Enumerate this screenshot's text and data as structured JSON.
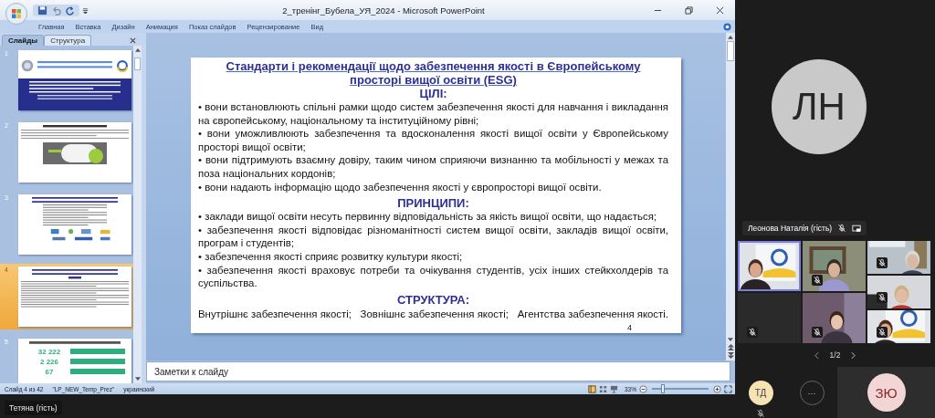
{
  "window": {
    "title": "2_тренінг_Бубела_УЯ_2024 - Microsoft PowerPoint"
  },
  "ribbon_tabs": [
    "Главная",
    "Вставка",
    "Дизайн",
    "Анимация",
    "Показ слайдов",
    "Рецензирование",
    "Вид"
  ],
  "pane_tabs": [
    {
      "label": "Слайды",
      "selected": true
    },
    {
      "label": "Структура",
      "selected": false
    }
  ],
  "thumbnails": [
    {
      "number": "1",
      "kind": "title-slide",
      "selected": false
    },
    {
      "number": "2",
      "kind": "text-photo",
      "selected": false
    },
    {
      "number": "3",
      "kind": "text-logos",
      "selected": false
    },
    {
      "number": "4",
      "kind": "text",
      "selected": true
    },
    {
      "number": "5",
      "kind": "figures",
      "selected": false,
      "texts": [
        "32 222",
        "2 226",
        "67"
      ]
    }
  ],
  "slide": {
    "title": "Стандарти і рекомендації щодо забезпечення якості в Європейському просторі вищої освіти (ESG)",
    "sections": [
      {
        "kind": "bullets",
        "heading": "ЦІЛІ:",
        "items": [
          "• вони встановлюють спільні рамки щодо систем забезпечення якості для навчання і викладання на європейському, національному та інституційному рівні;",
          "• вони уможливлюють забезпечення та вдосконалення якості вищої освіти у Європейському просторі вищої освіти;",
          "• вони підтримують взаємну довіру, таким чином сприяючи визнанню та мобільності у межах та поза національних кордонів;",
          "• вони надають інформацію щодо забезпечення якості у європросторі вищої освіти."
        ]
      },
      {
        "kind": "bullets",
        "heading": "ПРИНЦИПИ:",
        "items": [
          "• заклади вищої освіти несуть первинну відповідальність за якість вищої освіти, що надається;",
          "• забезпечення якості відповідає різноманітності систем вищої освіти, закладів вищої освіти, програм і студентів;",
          "• забезпечення якості сприяє розвитку культури якості;",
          "• забезпечення якості враховує потреби та очікування студентів, усіх інших стейкхолдерів та суспільства."
        ]
      },
      {
        "kind": "columns",
        "heading": "СТРУКТУРА:",
        "items": [
          "Внутрішнє забезпечення якості;",
          "Зовнішнє забезпечення якості;",
          "Агентства забезпечення якості."
        ]
      }
    ],
    "page_number": "4"
  },
  "notes": {
    "placeholder": "Заметки к слайду"
  },
  "status_bar": {
    "slide": "Слайд 4 из 42",
    "theme": "\"LP_NEW_Temp_Prez\"",
    "language": "украинский",
    "zoom": "33%",
    "zoom_slider": {
      "level": 0.2
    }
  },
  "guest_label": "Тетяна (гість)",
  "call": {
    "main_avatar": "ЛН",
    "speaker": {
      "name": "Леонова Наталія (гість)",
      "muted": true
    },
    "tiles": [
      {
        "kind": "video",
        "selected": true,
        "muted": false
      },
      {
        "kind": "video",
        "selected": false,
        "muted": true
      },
      {
        "kind": "video",
        "selected": false,
        "muted": true
      },
      {
        "kind": "video",
        "selected": false,
        "muted": true
      },
      {
        "kind": "empty",
        "selected": false,
        "muted": true
      },
      {
        "kind": "video",
        "selected": false,
        "muted": true
      },
      {
        "kind": "video",
        "selected": false,
        "muted": true
      }
    ],
    "pager": "1/2",
    "bottom": [
      {
        "kind": "avatar",
        "label": "ТД",
        "muted": true
      },
      {
        "kind": "more",
        "label": "···",
        "muted": false
      },
      {
        "kind": "avatar-tile",
        "label": "ЗЮ",
        "muted": false
      }
    ]
  }
}
